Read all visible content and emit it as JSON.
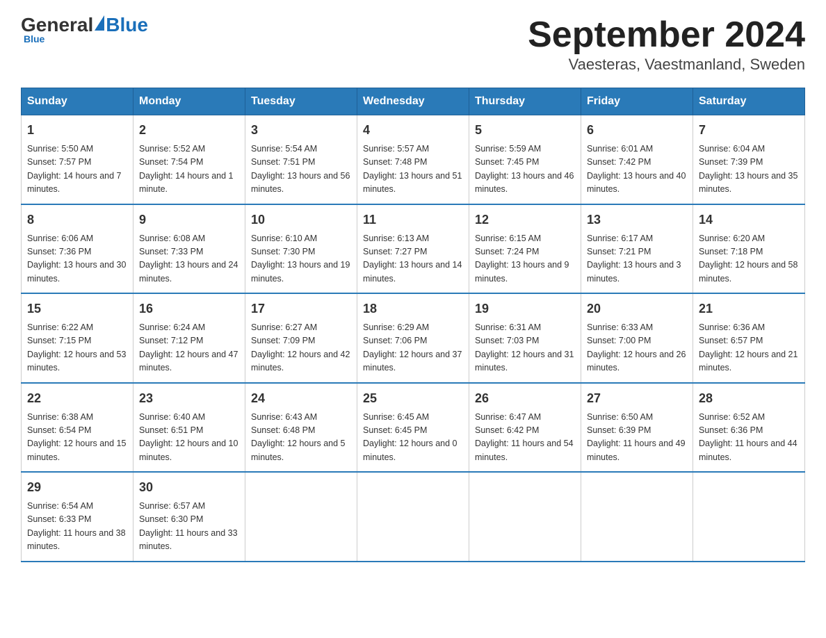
{
  "logo": {
    "general": "General",
    "blue": "Blue"
  },
  "title": "September 2024",
  "subtitle": "Vaesteras, Vaestmanland, Sweden",
  "days_of_week": [
    "Sunday",
    "Monday",
    "Tuesday",
    "Wednesday",
    "Thursday",
    "Friday",
    "Saturday"
  ],
  "weeks": [
    [
      {
        "day": "1",
        "sunrise": "5:50 AM",
        "sunset": "7:57 PM",
        "daylight": "14 hours and 7 minutes."
      },
      {
        "day": "2",
        "sunrise": "5:52 AM",
        "sunset": "7:54 PM",
        "daylight": "14 hours and 1 minute."
      },
      {
        "day": "3",
        "sunrise": "5:54 AM",
        "sunset": "7:51 PM",
        "daylight": "13 hours and 56 minutes."
      },
      {
        "day": "4",
        "sunrise": "5:57 AM",
        "sunset": "7:48 PM",
        "daylight": "13 hours and 51 minutes."
      },
      {
        "day": "5",
        "sunrise": "5:59 AM",
        "sunset": "7:45 PM",
        "daylight": "13 hours and 46 minutes."
      },
      {
        "day": "6",
        "sunrise": "6:01 AM",
        "sunset": "7:42 PM",
        "daylight": "13 hours and 40 minutes."
      },
      {
        "day": "7",
        "sunrise": "6:04 AM",
        "sunset": "7:39 PM",
        "daylight": "13 hours and 35 minutes."
      }
    ],
    [
      {
        "day": "8",
        "sunrise": "6:06 AM",
        "sunset": "7:36 PM",
        "daylight": "13 hours and 30 minutes."
      },
      {
        "day": "9",
        "sunrise": "6:08 AM",
        "sunset": "7:33 PM",
        "daylight": "13 hours and 24 minutes."
      },
      {
        "day": "10",
        "sunrise": "6:10 AM",
        "sunset": "7:30 PM",
        "daylight": "13 hours and 19 minutes."
      },
      {
        "day": "11",
        "sunrise": "6:13 AM",
        "sunset": "7:27 PM",
        "daylight": "13 hours and 14 minutes."
      },
      {
        "day": "12",
        "sunrise": "6:15 AM",
        "sunset": "7:24 PM",
        "daylight": "13 hours and 9 minutes."
      },
      {
        "day": "13",
        "sunrise": "6:17 AM",
        "sunset": "7:21 PM",
        "daylight": "13 hours and 3 minutes."
      },
      {
        "day": "14",
        "sunrise": "6:20 AM",
        "sunset": "7:18 PM",
        "daylight": "12 hours and 58 minutes."
      }
    ],
    [
      {
        "day": "15",
        "sunrise": "6:22 AM",
        "sunset": "7:15 PM",
        "daylight": "12 hours and 53 minutes."
      },
      {
        "day": "16",
        "sunrise": "6:24 AM",
        "sunset": "7:12 PM",
        "daylight": "12 hours and 47 minutes."
      },
      {
        "day": "17",
        "sunrise": "6:27 AM",
        "sunset": "7:09 PM",
        "daylight": "12 hours and 42 minutes."
      },
      {
        "day": "18",
        "sunrise": "6:29 AM",
        "sunset": "7:06 PM",
        "daylight": "12 hours and 37 minutes."
      },
      {
        "day": "19",
        "sunrise": "6:31 AM",
        "sunset": "7:03 PM",
        "daylight": "12 hours and 31 minutes."
      },
      {
        "day": "20",
        "sunrise": "6:33 AM",
        "sunset": "7:00 PM",
        "daylight": "12 hours and 26 minutes."
      },
      {
        "day": "21",
        "sunrise": "6:36 AM",
        "sunset": "6:57 PM",
        "daylight": "12 hours and 21 minutes."
      }
    ],
    [
      {
        "day": "22",
        "sunrise": "6:38 AM",
        "sunset": "6:54 PM",
        "daylight": "12 hours and 15 minutes."
      },
      {
        "day": "23",
        "sunrise": "6:40 AM",
        "sunset": "6:51 PM",
        "daylight": "12 hours and 10 minutes."
      },
      {
        "day": "24",
        "sunrise": "6:43 AM",
        "sunset": "6:48 PM",
        "daylight": "12 hours and 5 minutes."
      },
      {
        "day": "25",
        "sunrise": "6:45 AM",
        "sunset": "6:45 PM",
        "daylight": "12 hours and 0 minutes."
      },
      {
        "day": "26",
        "sunrise": "6:47 AM",
        "sunset": "6:42 PM",
        "daylight": "11 hours and 54 minutes."
      },
      {
        "day": "27",
        "sunrise": "6:50 AM",
        "sunset": "6:39 PM",
        "daylight": "11 hours and 49 minutes."
      },
      {
        "day": "28",
        "sunrise": "6:52 AM",
        "sunset": "6:36 PM",
        "daylight": "11 hours and 44 minutes."
      }
    ],
    [
      {
        "day": "29",
        "sunrise": "6:54 AM",
        "sunset": "6:33 PM",
        "daylight": "11 hours and 38 minutes."
      },
      {
        "day": "30",
        "sunrise": "6:57 AM",
        "sunset": "6:30 PM",
        "daylight": "11 hours and 33 minutes."
      },
      null,
      null,
      null,
      null,
      null
    ]
  ]
}
